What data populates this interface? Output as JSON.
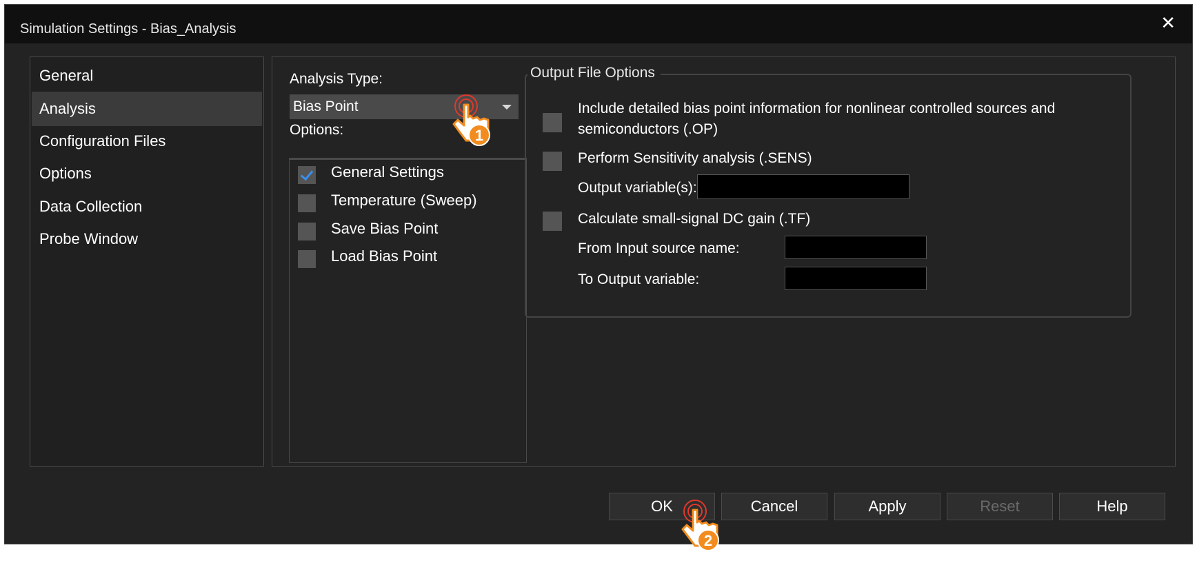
{
  "window": {
    "title": "Simulation Settings - Bias_Analysis",
    "close_glyph": "✕"
  },
  "sidebar": {
    "items": [
      {
        "label": "General",
        "selected": false
      },
      {
        "label": "Analysis",
        "selected": true
      },
      {
        "label": "Configuration Files",
        "selected": false
      },
      {
        "label": "Options",
        "selected": false
      },
      {
        "label": "Data Collection",
        "selected": false
      },
      {
        "label": "Probe Window",
        "selected": false
      }
    ]
  },
  "analysis": {
    "type_label": "Analysis Type:",
    "type_value": "Bias Point",
    "options_label": "Options:",
    "options": [
      {
        "label": "General Settings",
        "checked": true
      },
      {
        "label": "Temperature (Sweep)",
        "checked": false
      },
      {
        "label": "Save Bias Point",
        "checked": false
      },
      {
        "label": "Load Bias Point",
        "checked": false
      }
    ]
  },
  "output": {
    "group_title": "Output File Options",
    "op_line1": "Include detailed bias point information for nonlinear controlled sources and",
    "op_line2": "semiconductors (.OP)",
    "sens_label": "Perform Sensitivity analysis (.SENS)",
    "output_vars_label": "Output variable(s):",
    "output_vars_value": "",
    "tf_label": "Calculate small-signal DC gain (.TF)",
    "from_label": "From Input source name:",
    "from_value": "",
    "to_label": "To Output variable:",
    "to_value": ""
  },
  "buttons": {
    "ok": "OK",
    "cancel": "Cancel",
    "apply": "Apply",
    "reset": "Reset",
    "help": "Help"
  },
  "markers": [
    {
      "number": "1"
    },
    {
      "number": "2"
    }
  ],
  "colors": {
    "checkmark": "#3b8ee6",
    "marker_orange": "#f28c1e",
    "marker_ring": "#e0392b"
  }
}
